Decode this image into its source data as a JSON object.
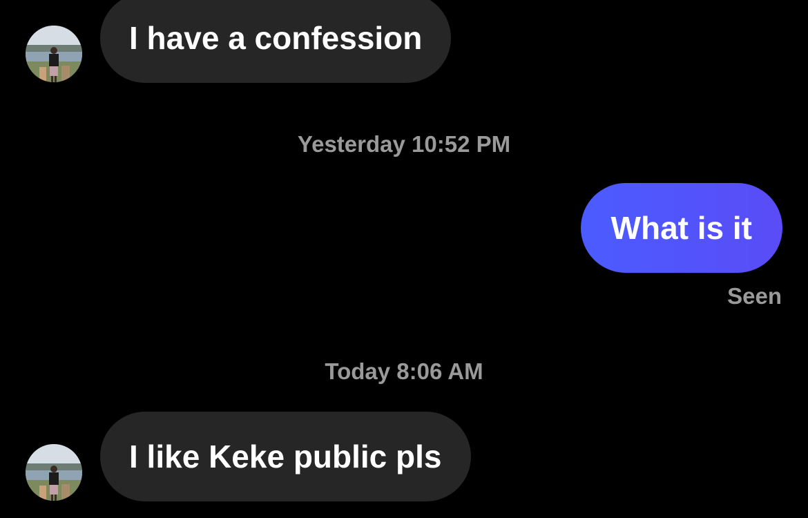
{
  "messages": {
    "incoming_1": {
      "text": "I have a confession"
    },
    "timestamp_1": "Yesterday 10:52 PM",
    "outgoing_1": {
      "text": "What is it",
      "status": "Seen"
    },
    "timestamp_2": "Today 8:06 AM",
    "incoming_2": {
      "text": "I like Keke public pls"
    }
  },
  "theme": {
    "background": "#000000",
    "incoming_bubble": "#262626",
    "outgoing_bubble": "#4a5cff",
    "muted_text": "#9a9a9a"
  },
  "icons": {
    "avatar": "contact-avatar-photo"
  }
}
